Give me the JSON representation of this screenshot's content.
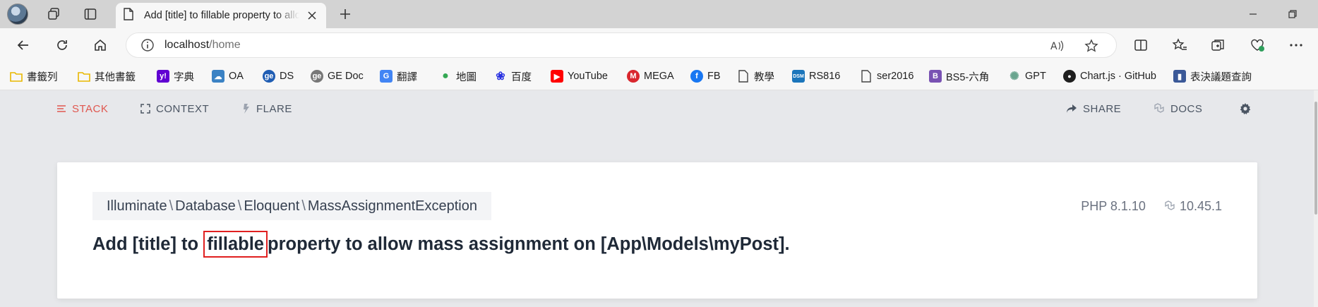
{
  "browser": {
    "tab_title": "Add [title] to fillable property to allow mass assignment on [App\\Models\\myPost].",
    "url_host": "localhost",
    "url_path": "/home"
  },
  "bookmarks": [
    {
      "label": "書籤列",
      "icon": "folder-icon",
      "color": "#e8b800"
    },
    {
      "label": "其他書籤",
      "icon": "folder-icon",
      "color": "#e8b800"
    },
    {
      "label": "字典",
      "icon": "yahoo-icon",
      "color": "#6001d2"
    },
    {
      "label": "OA",
      "icon": "cloud-icon",
      "color": "#3b82c4"
    },
    {
      "label": "DS",
      "icon": "ge-icon",
      "color": "#1f5db3"
    },
    {
      "label": "GE Doc",
      "icon": "ge-gray-icon",
      "color": "#777777"
    },
    {
      "label": "翻譯",
      "icon": "translate-icon",
      "color": "#4285f4"
    },
    {
      "label": "地圖",
      "icon": "maps-pin-icon",
      "color": "#34a853"
    },
    {
      "label": "百度",
      "icon": "baidu-paw-icon",
      "color": "#2932e1"
    },
    {
      "label": "YouTube",
      "icon": "youtube-icon",
      "color": "#ff0000"
    },
    {
      "label": "MEGA",
      "icon": "mega-icon",
      "color": "#d9272e"
    },
    {
      "label": "FB",
      "icon": "facebook-icon",
      "color": "#1877f2"
    },
    {
      "label": "教學",
      "icon": "document-icon",
      "color": "#444444"
    },
    {
      "label": "RS816",
      "icon": "dsm-icon",
      "color": "#1b75bb"
    },
    {
      "label": "ser2016",
      "icon": "document-icon",
      "color": "#444444"
    },
    {
      "label": "BS5-六角",
      "icon": "bootstrap-icon",
      "color": "#7952b3"
    },
    {
      "label": "GPT",
      "icon": "chatgpt-icon",
      "color": "#6aa58f"
    },
    {
      "label": "Chart.js · GitHub",
      "icon": "github-icon",
      "color": "#1f1f1f"
    },
    {
      "label": "表決議題查詢",
      "icon": "building-icon",
      "color": "#3b5998"
    }
  ],
  "ignition": {
    "nav": {
      "stack": "STACK",
      "context": "CONTEXT",
      "flare": "FLARE",
      "share": "SHARE",
      "docs": "DOCS"
    },
    "exception_parts": [
      "Illuminate",
      "Database",
      "Eloquent",
      "MassAssignmentException"
    ],
    "php_version": "PHP 8.1.10",
    "laravel_version": "10.45.1",
    "message_before": "Add [title] to",
    "message_highlight": "fillable",
    "message_after": "property to allow mass assignment on [App\\Models\\myPost]."
  },
  "colors": {
    "accent_red": "#e0574f",
    "highlight_box": "#e02020"
  }
}
